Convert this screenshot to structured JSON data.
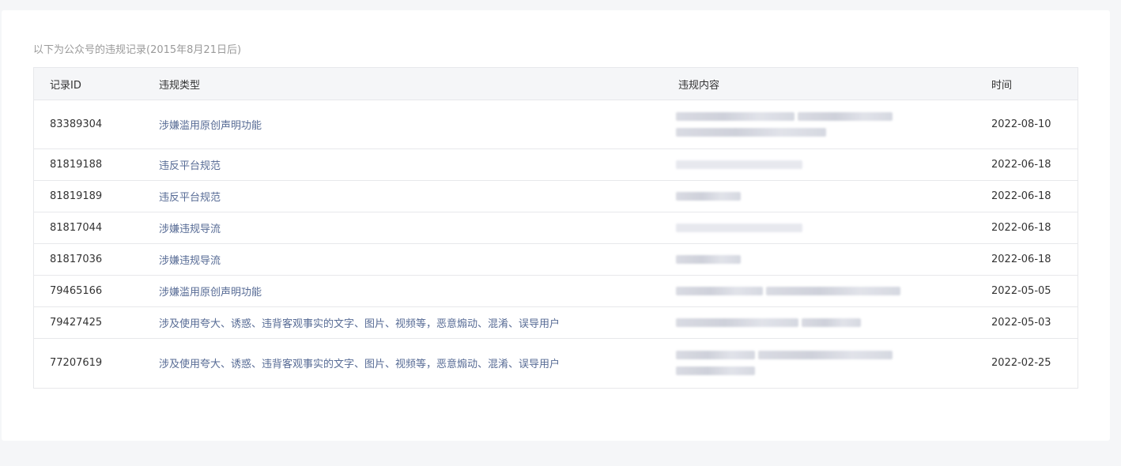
{
  "caption": "以下为公众号的违规记录(2015年8月21日后)",
  "table": {
    "headers": {
      "id": "记录ID",
      "type": "违规类型",
      "content": "违规内容",
      "time": "时间"
    },
    "rows": [
      {
        "id": "83389304",
        "type": "涉嫌滥用原创声明功能",
        "time": "2022-08-10"
      },
      {
        "id": "81819188",
        "type": "违反平台规范",
        "time": "2022-06-18"
      },
      {
        "id": "81819189",
        "type": "违反平台规范",
        "time": "2022-06-18"
      },
      {
        "id": "81817044",
        "type": "涉嫌违规导流",
        "time": "2022-06-18"
      },
      {
        "id": "81817036",
        "type": "涉嫌违规导流",
        "time": "2022-06-18"
      },
      {
        "id": "79465166",
        "type": "涉嫌滥用原创声明功能",
        "time": "2022-05-05"
      },
      {
        "id": "79427425",
        "type": "涉及使用夸大、诱惑、违背客观事实的文字、图片、视频等，恶意煽动、混淆、误导用户",
        "time": "2022-05-03"
      },
      {
        "id": "77207619",
        "type": "涉及使用夸大、诱惑、违背客观事实的文字、图片、视频等，恶意煽动、混淆、误导用户",
        "time": "2022-02-25"
      }
    ]
  }
}
